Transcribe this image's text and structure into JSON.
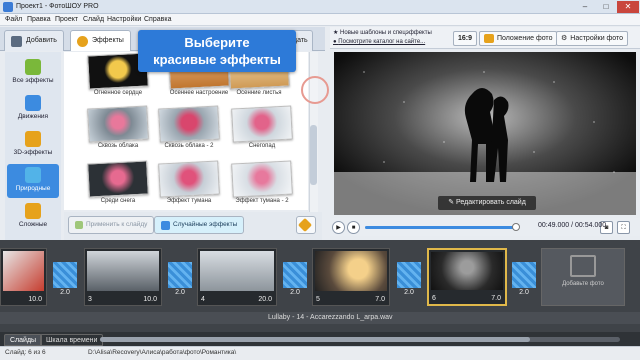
{
  "window": {
    "title": "Проект1 - ФотоШОУ PRO"
  },
  "menu": [
    "Файл",
    "Правка",
    "Проект",
    "Слайд",
    "Настройки",
    "Справка"
  ],
  "tabs": {
    "add": "Добавить",
    "effects": "Эффекты",
    "last_fragment": "дать"
  },
  "callout": {
    "line1": "Выберите",
    "line2": "красивые эффекты"
  },
  "categories": [
    {
      "label": "Все эффекты",
      "icon": "puzzle-icon",
      "color": "#7ab83a"
    },
    {
      "label": "Движения",
      "icon": "arrows-icon",
      "color": "#3c8be0"
    },
    {
      "label": "3D-эффекты",
      "icon": "cube-icon",
      "color": "#e6a21c"
    },
    {
      "label": "Природные",
      "icon": "snowflake-icon",
      "color": "#52b3e8"
    },
    {
      "label": "Сложные",
      "icon": "layers-icon",
      "color": "#e6a21c"
    }
  ],
  "effects": [
    {
      "label": "Огненное сердце"
    },
    {
      "label": "Осеннее настроение"
    },
    {
      "label": "Осенние листья"
    },
    {
      "label": "Сквозь облака"
    },
    {
      "label": "Сквозь облака - 2"
    },
    {
      "label": "Снегопад"
    },
    {
      "label": "Среди снега"
    },
    {
      "label": "Эффект тумана"
    },
    {
      "label": "Эффект тумана - 2"
    }
  ],
  "actions": {
    "apply": "Применить к слайду",
    "random": "Случайные эффекты"
  },
  "right_top": {
    "link1": "Новые шаблоны и спецэффекты",
    "link2": "Посмотрите каталог на сайте...",
    "ratio": "16:9",
    "photo_position": "Положение фото",
    "photo_settings": "Настройки фото"
  },
  "preview": {
    "edit_button": "Редактировать слайд"
  },
  "player": {
    "time": "00:49.000 / 00:54.000"
  },
  "slides": [
    {
      "num": "",
      "duration": "10.0"
    },
    {
      "num": "3",
      "duration": "10.0"
    },
    {
      "num": "4",
      "duration": "20.0"
    },
    {
      "num": "5",
      "duration": "7.0"
    },
    {
      "num": "6",
      "duration": "7.0"
    }
  ],
  "transitions": [
    "2.0",
    "2.0",
    "2.0",
    "2.0",
    "2.0"
  ],
  "add_photo": "Добавьте фото",
  "audio": {
    "track": "Lullaby - 14 - Accarezzando L_arpa.wav"
  },
  "bottom_tabs": {
    "slides": "Слайды",
    "timeline": "Шкала времени"
  },
  "status": {
    "count": "Слайд: 6 из 6",
    "path": "D:\\Alisa\\Recovery\\Алиса\\работа\\фото\\Романтика\\"
  }
}
